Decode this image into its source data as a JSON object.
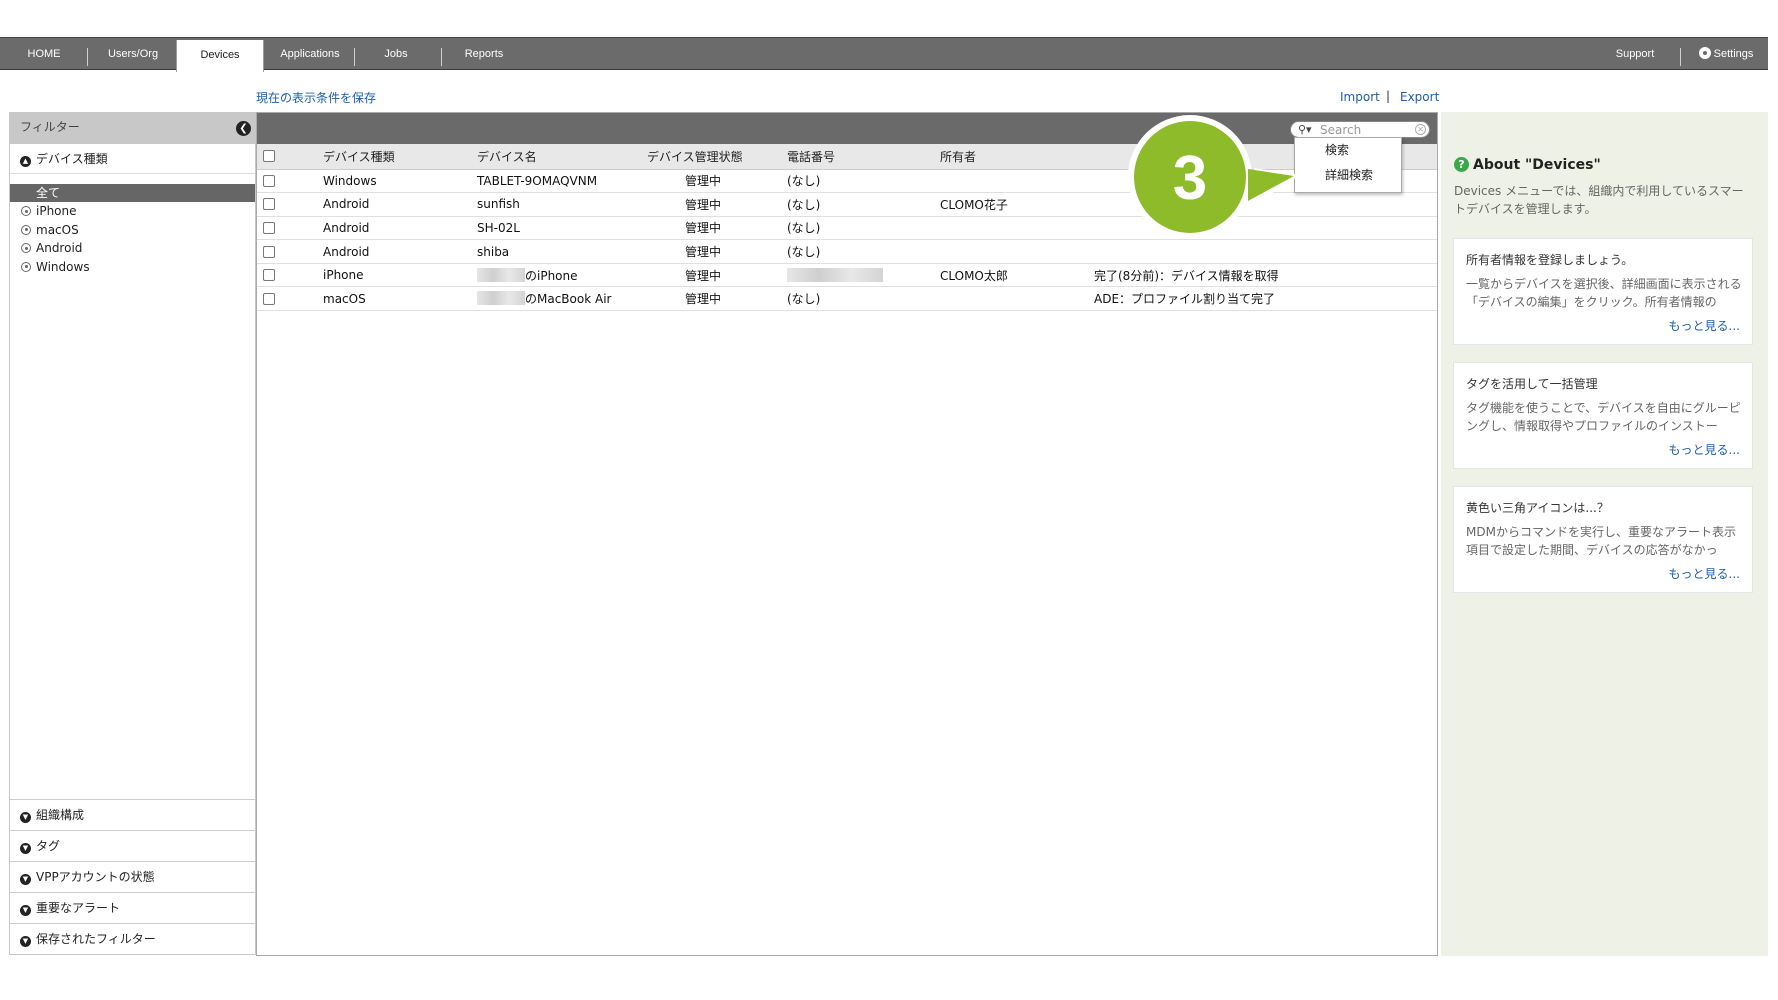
{
  "nav": {
    "home": "HOME",
    "users": "Users/Org",
    "devices": "Devices",
    "applications": "Applications",
    "jobs": "Jobs",
    "reports": "Reports",
    "support": "Support",
    "settings": "Settings",
    "settings_icon": "gear-icon"
  },
  "links": {
    "save_view": "現在の表示条件を保存",
    "import": "Import",
    "separator": "|",
    "export": "Export"
  },
  "filter": {
    "title": "フィルター",
    "device_type_section": "デバイス種類",
    "items": [
      "全て",
      "iPhone",
      "macOS",
      "Android",
      "Windows"
    ],
    "selected": "全て",
    "bottom_sections": [
      "組織構成",
      "タグ",
      "VPPアカウントの状態",
      "重要なアラート",
      "保存されたフィルター"
    ]
  },
  "search": {
    "placeholder": "Search",
    "menu": [
      "検索",
      "詳細検索"
    ]
  },
  "table": {
    "columns": [
      "デバイス種類",
      "デバイス名",
      "デバイス管理状態",
      "電話番号",
      "所有者",
      ""
    ],
    "rows": [
      {
        "type": "Windows",
        "name": "TABLET-9OMAQVNM",
        "status": "管理中",
        "phone": "(なし)",
        "owner": "",
        "job": ""
      },
      {
        "type": "Android",
        "name": "sunfish",
        "status": "管理中",
        "phone": "(なし)",
        "owner": "CLOMO花子",
        "job": ""
      },
      {
        "type": "Android",
        "name": "SH-02L",
        "status": "管理中",
        "phone": "(なし)",
        "owner": "",
        "job": ""
      },
      {
        "type": "Android",
        "name": "shiba",
        "status": "管理中",
        "phone": "(なし)",
        "owner": "",
        "job": ""
      },
      {
        "type": "iPhone",
        "name": "のiPhone",
        "status": "管理中",
        "phone": "",
        "owner": "CLOMO太郎",
        "job": "完了(8分前)：デバイス情報を取得"
      },
      {
        "type": "macOS",
        "name": "のMacBook Air",
        "status": "管理中",
        "phone": "(なし)",
        "owner": "",
        "job": "ADE：プロファイル割り当て完了"
      }
    ]
  },
  "callout": {
    "number": "3",
    "color": "#8dbb2a"
  },
  "help": {
    "title": "About \"Devices\"",
    "description": "Devices メニューでは、組織内で利用しているスマートデバイスを管理します。",
    "cards": [
      {
        "title": "所有者情報を登録しましょう。",
        "body": "一覧からデバイスを選択後、詳細画面に表示される「デバイスの編集」をクリック。所有者情報の",
        "more": "もっと見る..."
      },
      {
        "title": "タグを活用して一括管理",
        "body": "タグ機能を使うことで、デバイスを自由にグルーピングし、情報取得やプロファイルのインストー",
        "more": "もっと見る..."
      },
      {
        "title": "黄色い三角アイコンは...？",
        "body": "MDMからコマンドを実行し、重要なアラート表示項目で設定した期間、デバイスの応答がなかっ",
        "more": "もっと見る..."
      }
    ]
  }
}
